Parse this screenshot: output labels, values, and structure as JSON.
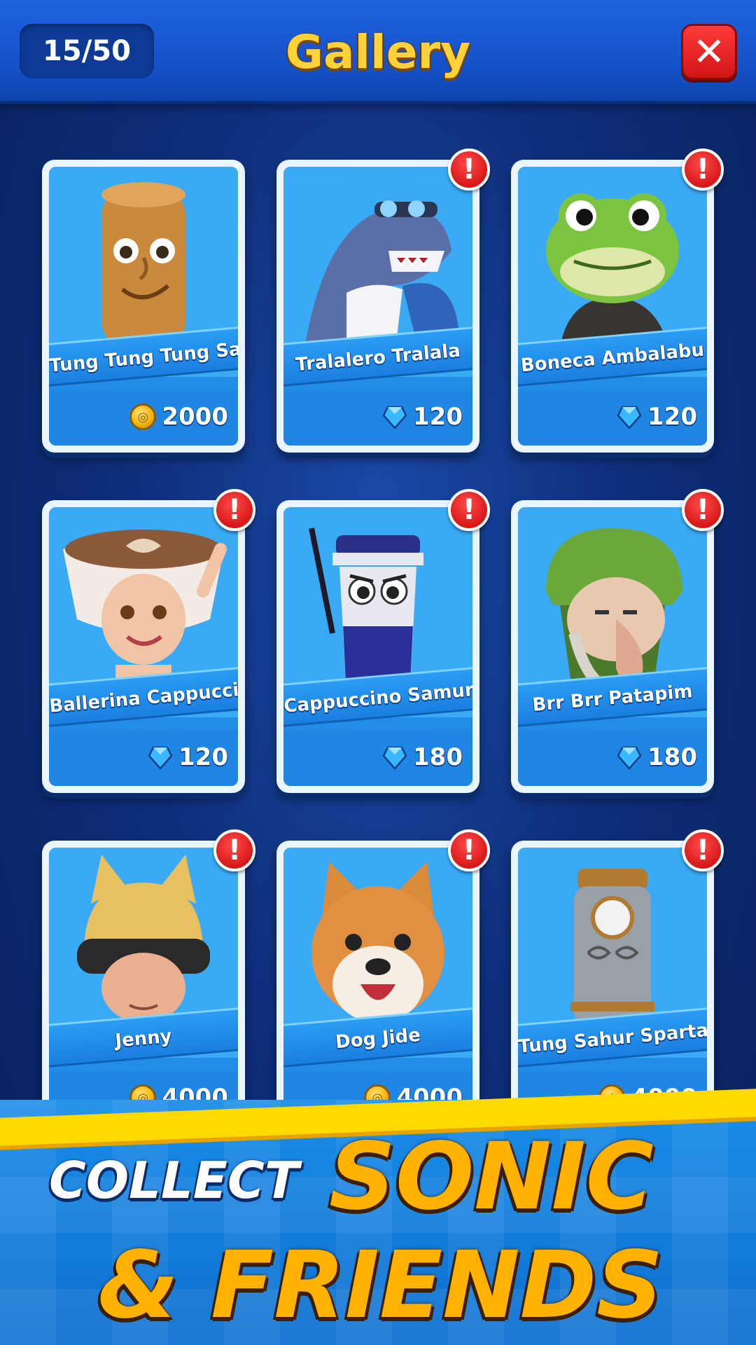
{
  "header": {
    "counter": "15/50",
    "title": "Gallery",
    "close_icon": "close-icon"
  },
  "cards": [
    {
      "name": "Tung Tung Tung Sahur",
      "price": "2000",
      "currency": "coin",
      "alert": false
    },
    {
      "name": "Tralalero Tralala",
      "price": "120",
      "currency": "gem",
      "alert": true
    },
    {
      "name": "Boneca Ambalabu",
      "price": "120",
      "currency": "gem",
      "alert": true
    },
    {
      "name": "Ballerina Cappuccina",
      "price": "120",
      "currency": "gem",
      "alert": true
    },
    {
      "name": "Cappuccino Samurai",
      "price": "180",
      "currency": "gem",
      "alert": true
    },
    {
      "name": "Brr Brr Patapim",
      "price": "180",
      "currency": "gem",
      "alert": true
    },
    {
      "name": "Jenny",
      "price": "4000",
      "currency": "coin",
      "alert": true
    },
    {
      "name": "Dog Jide",
      "price": "4000",
      "currency": "coin",
      "alert": true
    },
    {
      "name": "Tung Sahur Sparta",
      "price": "4000",
      "currency": "coin",
      "alert": true
    }
  ],
  "alert_mark": "!",
  "banner": {
    "line1": "COLLECT",
    "line1_accent": "SONIC",
    "line2": "& FRIENDS"
  },
  "colors": {
    "header": "#1450c6",
    "card_blue": "#1f86e4",
    "title_gold": "#ffd23a",
    "alert_red": "#d81818",
    "banner_gold": "#ffb300"
  }
}
